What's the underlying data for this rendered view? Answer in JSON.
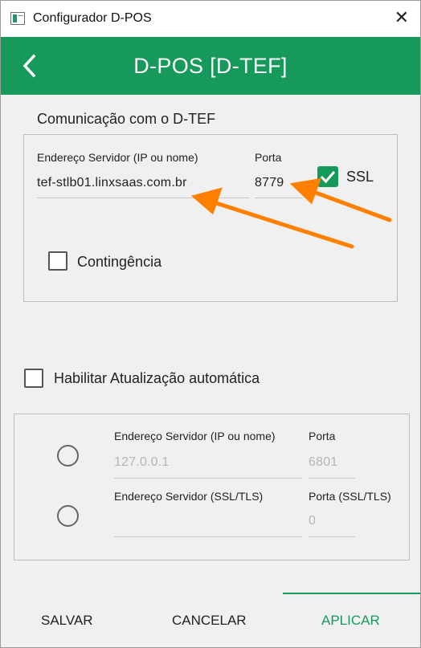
{
  "window": {
    "title": "Configurador D-POS",
    "close": "✕"
  },
  "header": {
    "back": "‹",
    "title": "D-POS [D-TEF]"
  },
  "comm": {
    "section_label": "Comunicação com o D-TEF",
    "server_label": "Endereço Servidor (IP ou nome)",
    "server_value": "tef-stlb01.linxsaas.com.br",
    "port_label": "Porta",
    "port_value": "8779",
    "ssl_label": "SSL",
    "ssl_checked": true,
    "contingency_label": "Contingência",
    "contingency_checked": false
  },
  "auto_update": {
    "label": "Habilitar Atualização automática",
    "checked": false,
    "row1": {
      "server_label": "Endereço Servidor (IP ou nome)",
      "server_value": "127.0.0.1",
      "port_label": "Porta",
      "port_value": "6801"
    },
    "row2": {
      "server_label": "Endereço Servidor (SSL/TLS)",
      "server_value": "",
      "port_label": "Porta (SSL/TLS)",
      "port_value": "0"
    }
  },
  "footer": {
    "save": "SALVAR",
    "cancel": "CANCELAR",
    "apply": "APLICAR"
  },
  "colors": {
    "accent": "#16995a",
    "annotation_arrow": "#ff8000"
  }
}
